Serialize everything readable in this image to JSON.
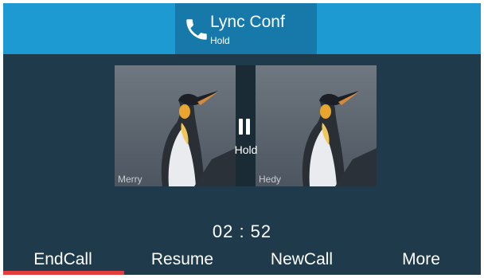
{
  "header": {
    "title": "Lync Conf",
    "status": "Hold",
    "icon": "phone-icon"
  },
  "participants": [
    {
      "name": "Merry"
    },
    {
      "name": "Hedy"
    }
  ],
  "hold_indicator": {
    "icon": "pause-icon",
    "label": "Hold"
  },
  "timer": "02 : 52",
  "softkeys": [
    {
      "label": "EndCall"
    },
    {
      "label": "Resume"
    },
    {
      "label": "NewCall"
    },
    {
      "label": "More"
    }
  ],
  "colors": {
    "background": "#1f3a4a",
    "header": "#1d9ad2",
    "header_title_box": "#1779a9",
    "endcall_indicator": "#e23c3c"
  }
}
